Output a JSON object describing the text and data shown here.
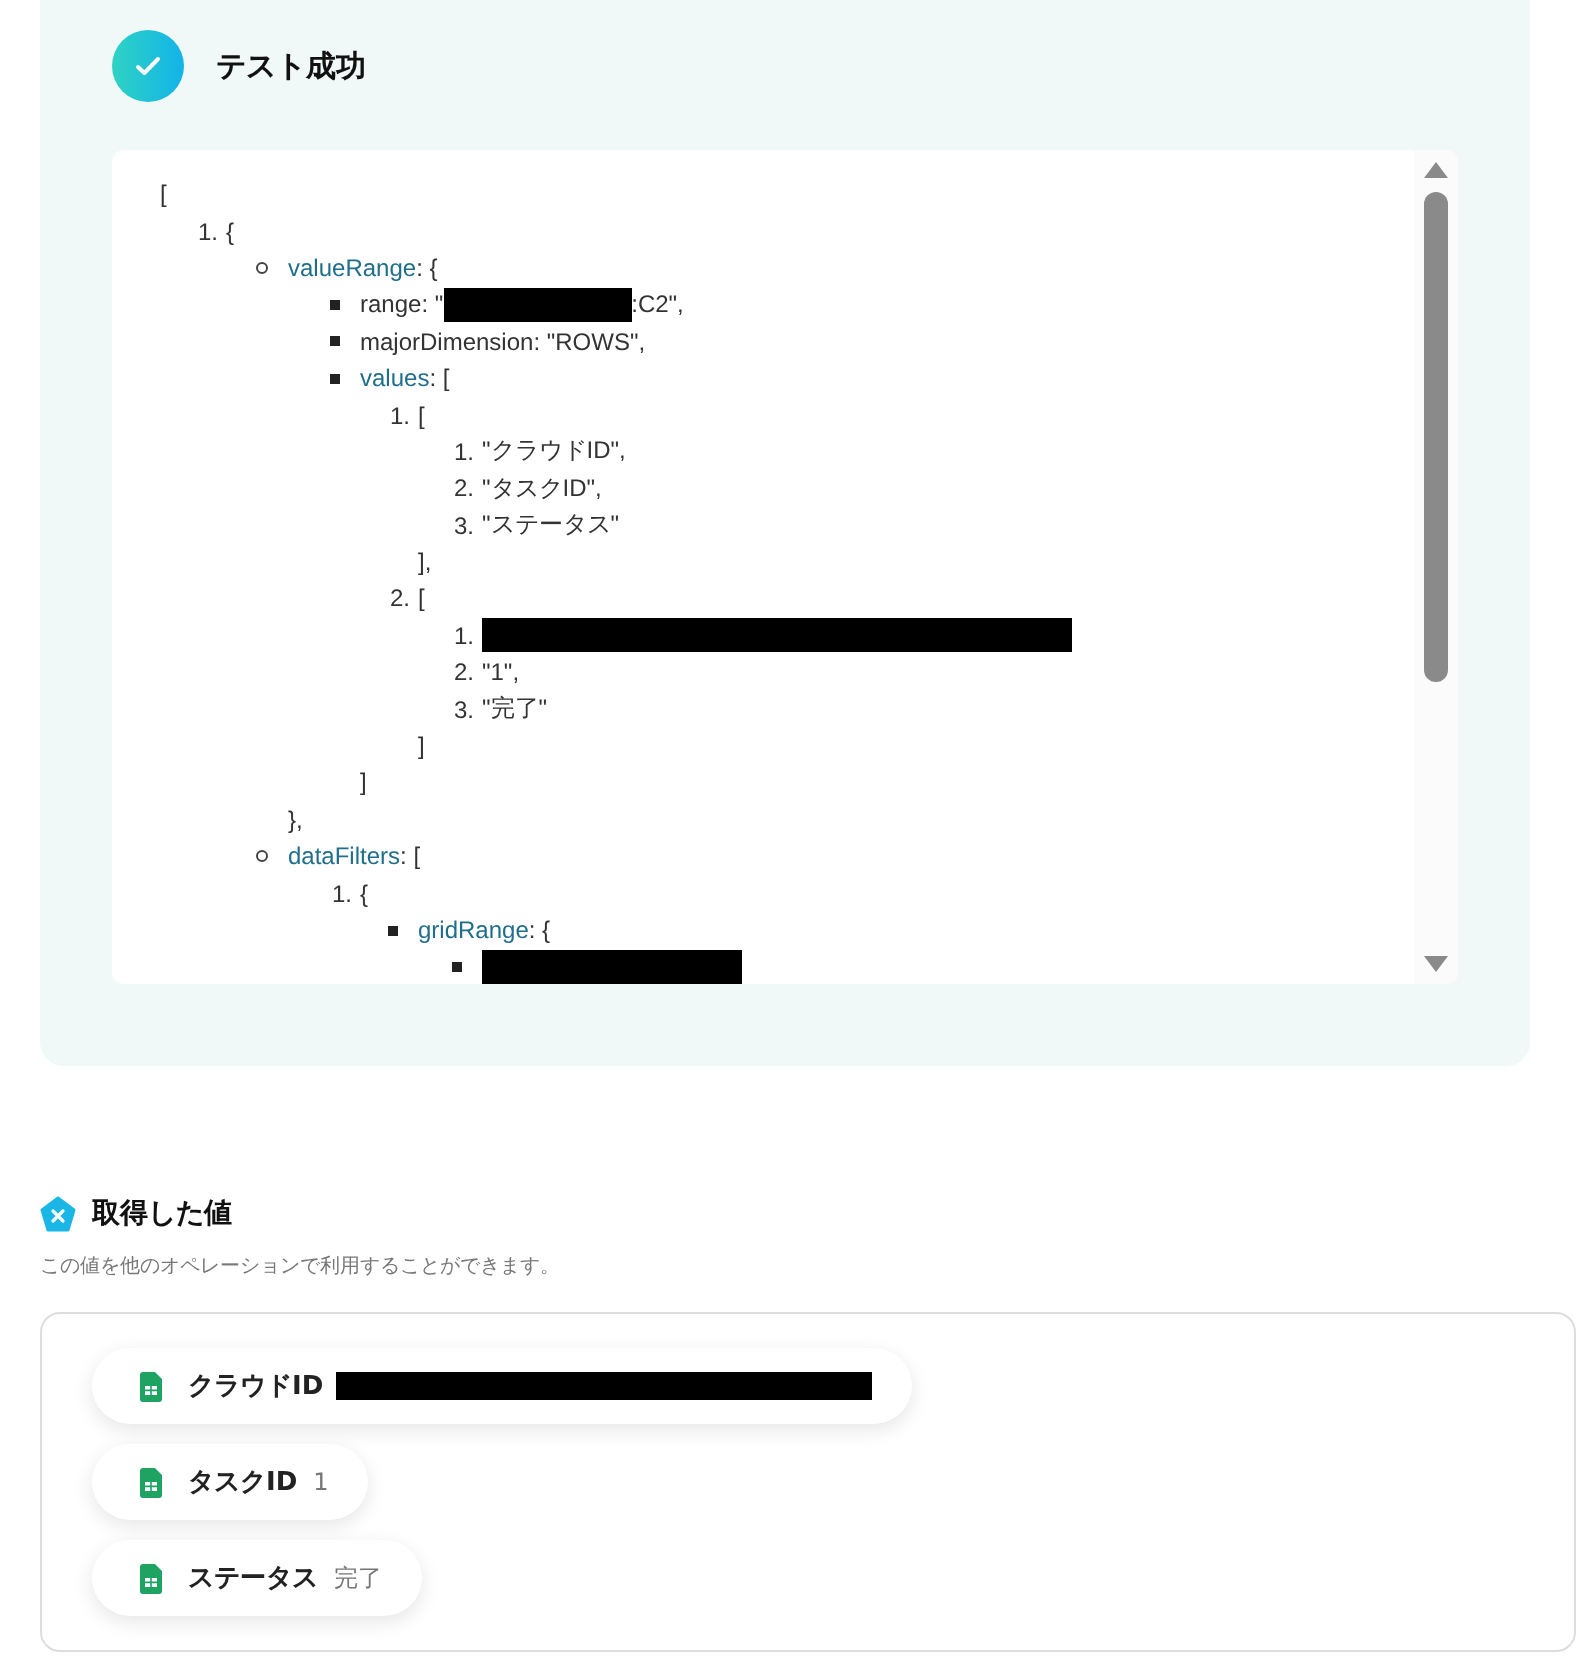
{
  "result": {
    "title": "テスト成功",
    "success": true,
    "code": [
      {
        "text": "[",
        "children": [
          {
            "kind": "numbered",
            "number": "1.",
            "text": "{",
            "children": [
              {
                "kind": "circle",
                "key": "valueRange",
                "text": ": {",
                "close": "},",
                "children": [
                  {
                    "kind": "square",
                    "text": "range: \"",
                    "redacted": true,
                    "after": ":C2\","
                  },
                  {
                    "kind": "square",
                    "text": "majorDimension: \"ROWS\","
                  },
                  {
                    "kind": "square",
                    "key": "values",
                    "text": ": [",
                    "close": "]",
                    "children": [
                      {
                        "kind": "numbered",
                        "number": "1.",
                        "text": "[",
                        "close": "],",
                        "children": [
                          {
                            "kind": "numbered",
                            "number": "1.",
                            "text": "\"クラウドID\","
                          },
                          {
                            "kind": "numbered",
                            "number": "2.",
                            "text": "\"タスクID\","
                          },
                          {
                            "kind": "numbered",
                            "number": "3.",
                            "text": "\"ステータス\""
                          }
                        ]
                      },
                      {
                        "kind": "numbered",
                        "number": "2.",
                        "text": "[",
                        "close": "]",
                        "children": [
                          {
                            "kind": "numbered",
                            "number": "1.",
                            "redacted": true
                          },
                          {
                            "kind": "numbered",
                            "number": "2.",
                            "text": "\"1\","
                          },
                          {
                            "kind": "numbered",
                            "number": "3.",
                            "text": "\"完了\""
                          }
                        ]
                      }
                    ]
                  }
                ]
              },
              {
                "kind": "circle",
                "key": "dataFilters",
                "text": ": [",
                "children": [
                  {
                    "kind": "numbered",
                    "number": "1.",
                    "text": "{",
                    "children": [
                      {
                        "kind": "square",
                        "key": "gridRange",
                        "text": ": {",
                        "children": [
                          {
                            "kind": "square",
                            "redacted": true
                          }
                        ]
                      }
                    ]
                  }
                ]
              }
            ]
          }
        ]
      }
    ]
  },
  "values": {
    "title": "取得した値",
    "description": "この値を他のオペレーションで利用することができます。",
    "chips": [
      {
        "label": "クラウドID",
        "redacted": true
      },
      {
        "label": "タスクID",
        "value": "1"
      },
      {
        "label": "ステータス",
        "value": "完了"
      }
    ]
  }
}
